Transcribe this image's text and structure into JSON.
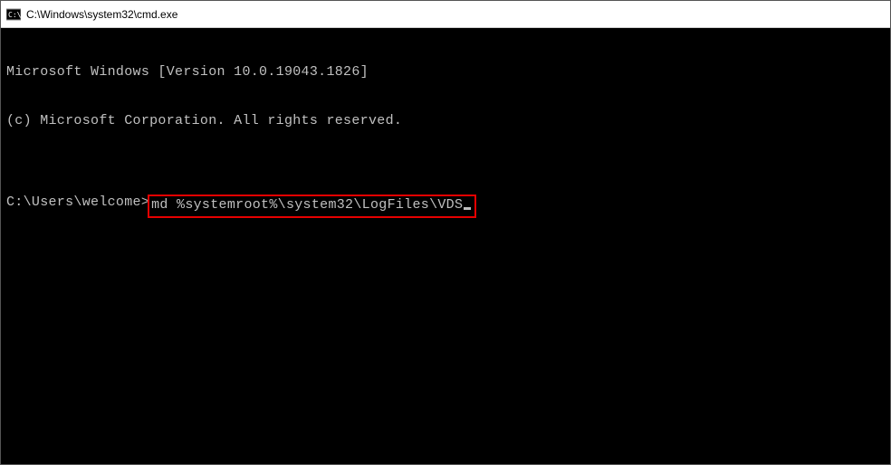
{
  "titlebar": {
    "path": "C:\\Windows\\system32\\cmd.exe"
  },
  "terminal": {
    "line1": "Microsoft Windows [Version 10.0.19043.1826]",
    "line2": "(c) Microsoft Corporation. All rights reserved.",
    "blank": "",
    "prompt": "C:\\Users\\welcome>",
    "command": "md %systemroot%\\system32\\LogFiles\\VDS"
  }
}
